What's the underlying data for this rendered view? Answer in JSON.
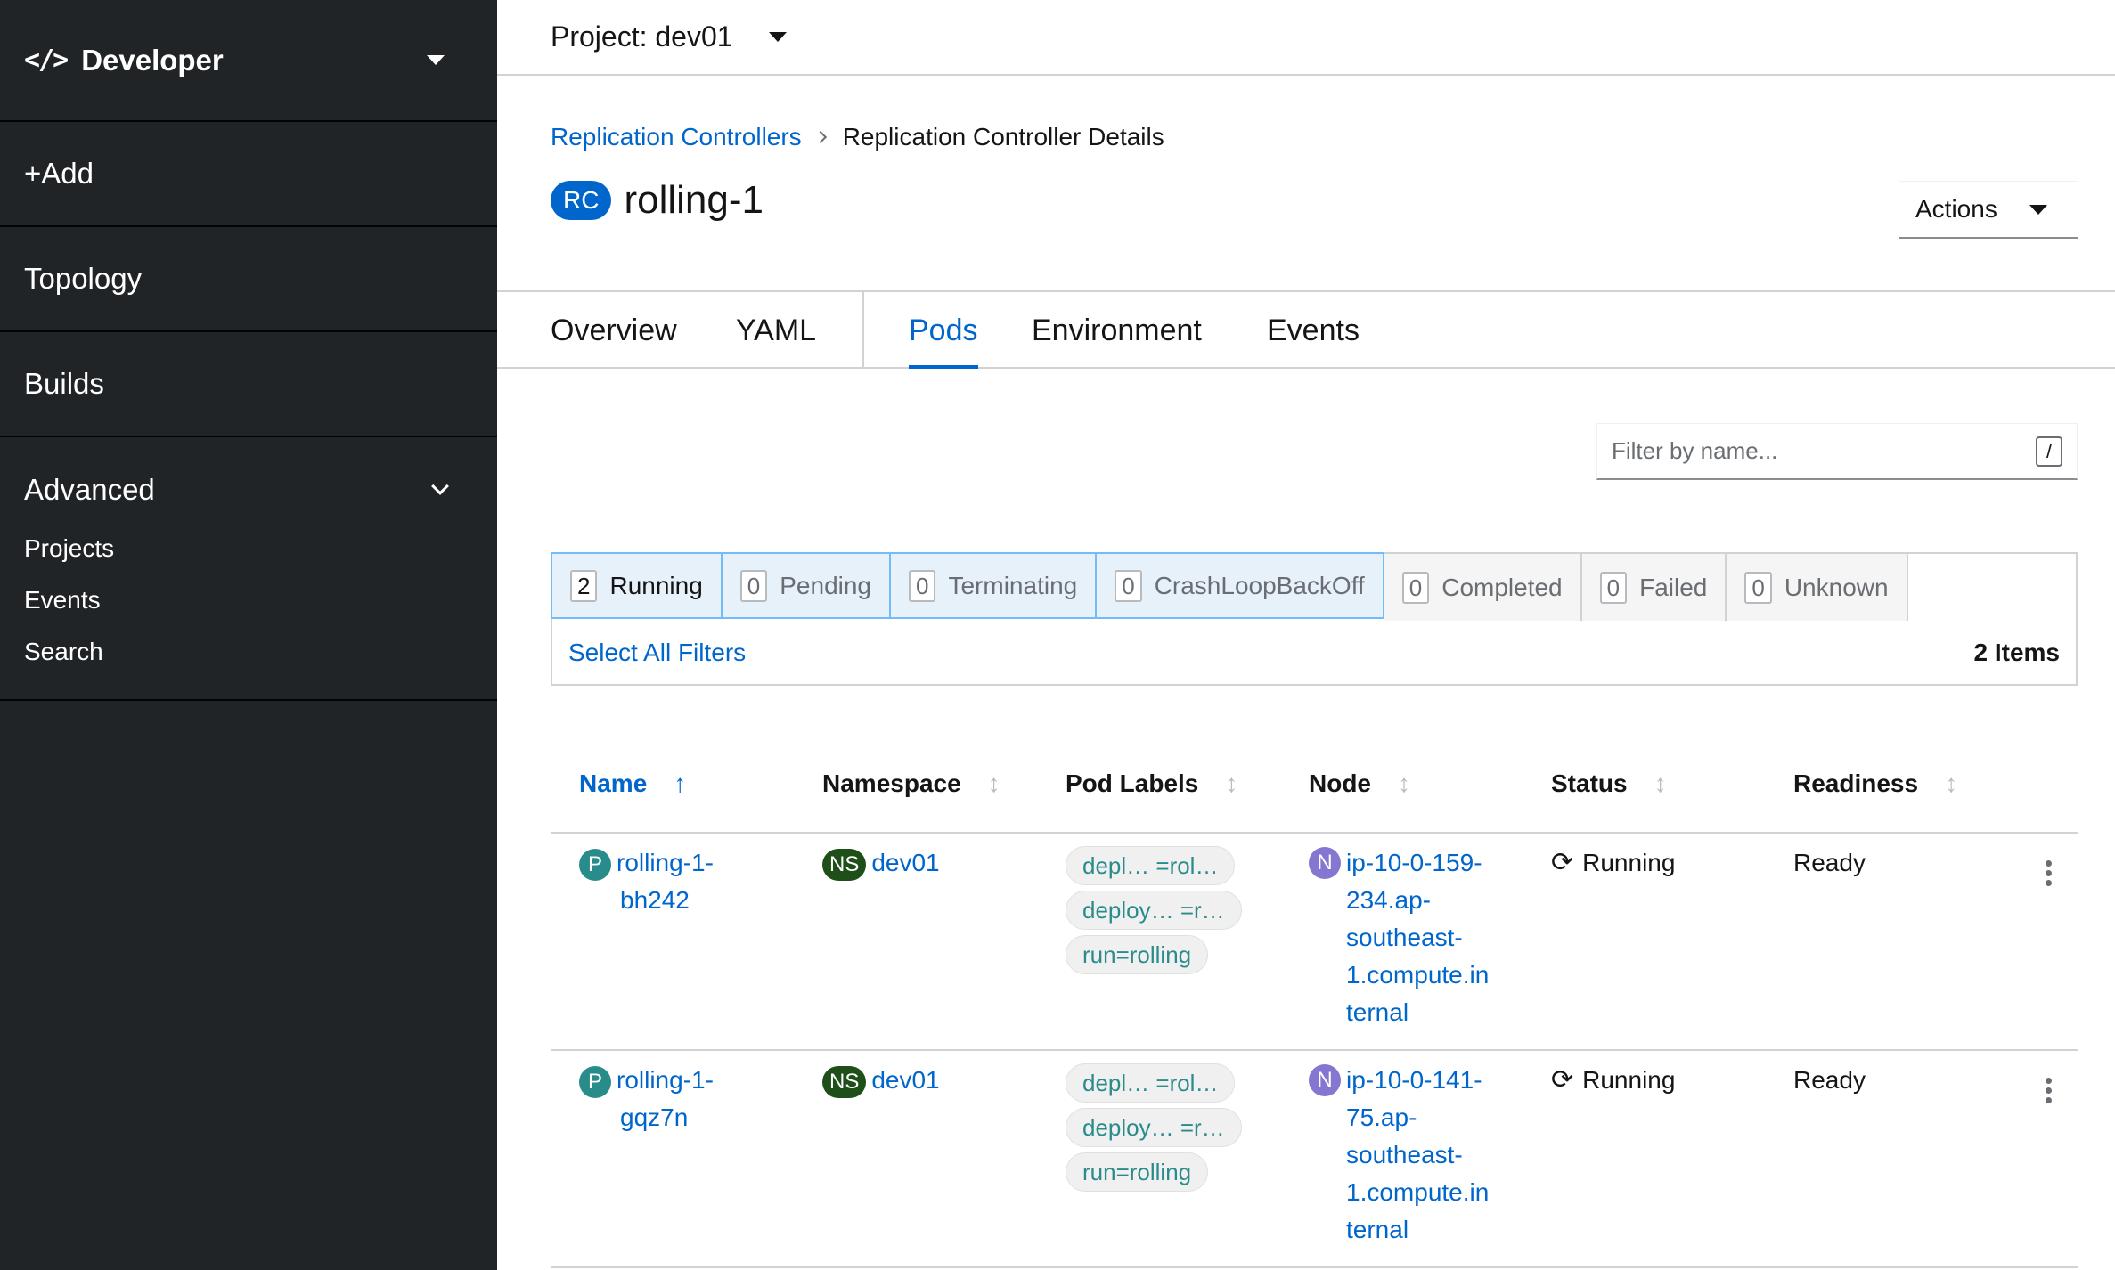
{
  "sidebar": {
    "perspective": "Developer",
    "items": [
      "+Add",
      "Topology",
      "Builds"
    ],
    "advanced": "Advanced",
    "sub_items": [
      "Projects",
      "Events",
      "Search"
    ]
  },
  "project": "Project: dev01",
  "breadcrumb": {
    "parent": "Replication Controllers",
    "current": "Replication Controller Details"
  },
  "header": {
    "badge": "RC",
    "title": "rolling-1",
    "actions": "Actions"
  },
  "tabs": [
    "Overview",
    "YAML",
    "Pods",
    "Environment",
    "Events"
  ],
  "filter": {
    "placeholder": "Filter by name...",
    "shortcut": "/"
  },
  "status_filters": [
    {
      "count": "2",
      "label": "Running"
    },
    {
      "count": "0",
      "label": "Pending"
    },
    {
      "count": "0",
      "label": "Terminating"
    },
    {
      "count": "0",
      "label": "CrashLoopBackOff"
    },
    {
      "count": "0",
      "label": "Completed"
    },
    {
      "count": "0",
      "label": "Failed"
    },
    {
      "count": "0",
      "label": "Unknown"
    }
  ],
  "select_all": "Select All Filters",
  "items_count": "2 Items",
  "columns": [
    "Name",
    "Namespace",
    "Pod Labels",
    "Node",
    "Status",
    "Readiness"
  ],
  "rows": [
    {
      "badge": "P",
      "name_l1": "rolling-1-",
      "name_l2": "bh242",
      "ns_badge": "NS",
      "namespace": "dev01",
      "labels": [
        "depl… =rol…",
        "deploy… =r…",
        "run=rolling"
      ],
      "node_badge": "N",
      "node_lines": [
        "ip-10-0-159-",
        "234.ap-",
        "southeast-",
        "1.compute.in",
        "ternal"
      ],
      "status": "Running",
      "readiness": "Ready"
    },
    {
      "badge": "P",
      "name_l1": "rolling-1-",
      "name_l2": "gqz7n",
      "ns_badge": "NS",
      "namespace": "dev01",
      "labels": [
        "depl… =rol…",
        "deploy… =r…",
        "run=rolling"
      ],
      "node_badge": "N",
      "node_lines": [
        "ip-10-0-141-",
        "75.ap-",
        "southeast-",
        "1.compute.in",
        "ternal"
      ],
      "status": "Running",
      "readiness": "Ready"
    }
  ],
  "colors": {
    "sidebar": "#212427",
    "link": "#0066cc",
    "pod_badge": "#2a8b8b",
    "ns_badge": "#1e4f18",
    "node_badge": "#8476d1"
  }
}
